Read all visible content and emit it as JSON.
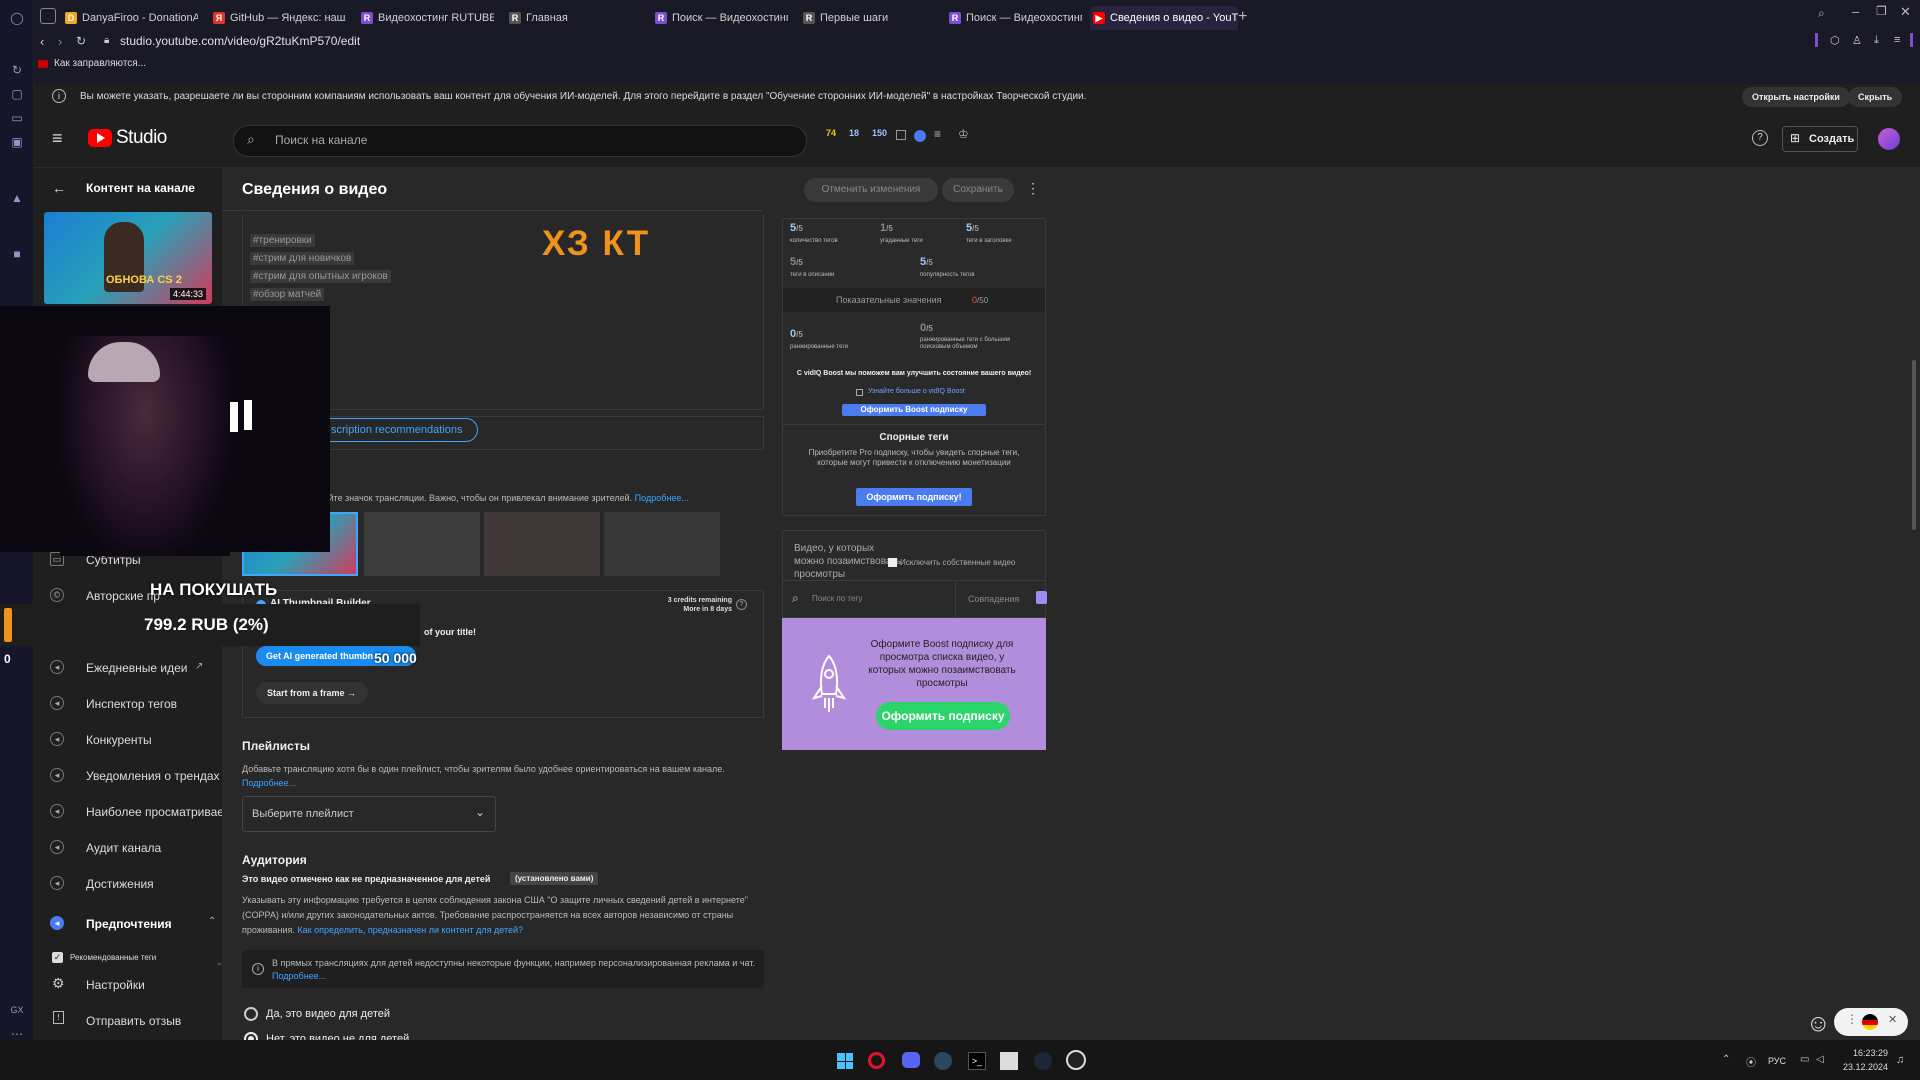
{
  "browser": {
    "tabs": [
      {
        "label": "DanyaFiroo - DonationAle",
        "fav_color": "#f5a623"
      },
      {
        "label": "GitHub — Яндекс: нашло",
        "fav_color": "#e5322d"
      },
      {
        "label": "Видеохостинг RUTUBE. С",
        "fav_color": "#7b4dd8"
      },
      {
        "label": "Главная",
        "fav_color": "#444"
      },
      {
        "label": "Поиск — Видеохостинг R",
        "fav_color": "#7b4dd8"
      },
      {
        "label": "Первые шаги",
        "fav_color": "#444"
      },
      {
        "label": "Поиск — Видеохостинг R",
        "fav_color": "#7b4dd8"
      },
      {
        "label": "Сведения о видео - YouT",
        "fav_color": "#ff0000"
      }
    ],
    "url": "studio.youtube.com/video/gR2tuKmP570/edit",
    "bookmark": "Как заправляются..."
  },
  "banner": {
    "text": "Вы можете указать, разрешаете ли вы сторонним компаниям использовать ваш контент для обучения ИИ-моделей. Для этого перейдите в раздел \"Обучение сторонних ИИ-моделей\" в настройках Творческой студии.",
    "open_settings": "Открыть настройки",
    "hide": "Скрыть"
  },
  "header": {
    "logo_text": "Studio",
    "search_placeholder": "Поиск на канале",
    "stats": {
      "a": "74",
      "b": "18",
      "c": "150"
    },
    "create_label": "Создать"
  },
  "sidebar": {
    "back_label": "Контент на канале",
    "thumb_duration": "4:44:33",
    "thumb_text": "ОБНОВА CS 2",
    "items": [
      {
        "label": "Субтитры",
        "icon": "subtitles-icon"
      },
      {
        "label": "Авторские пр",
        "icon": "copyright-icon"
      },
      {
        "label": "Ежедневные идеи",
        "icon": "vidiq-icon"
      },
      {
        "label": "Инспектор тегов",
        "icon": "vidiq-icon"
      },
      {
        "label": "Конкуренты",
        "icon": "vidiq-icon"
      },
      {
        "label": "Уведомления о трендах",
        "icon": "vidiq-icon"
      },
      {
        "label": "Наиболее просматривае",
        "icon": "vidiq-icon"
      },
      {
        "label": "Аудит канала",
        "icon": "vidiq-icon"
      },
      {
        "label": "Достижения",
        "icon": "vidiq-icon"
      },
      {
        "label": "Предпочтения",
        "icon": "vidiq-icon"
      }
    ],
    "recommended_tags": "Рекомендованные теги",
    "settings": "Настройки",
    "feedback": "Отправить отзыв"
  },
  "main": {
    "title": "Сведения о видео",
    "undo": "Отменить изменения",
    "save": "Сохранить",
    "overlay_text": "ХЗ КТ",
    "tags": [
      "#тренировки",
      "#стрим для новичков",
      "#стрим для опытных игроков",
      "#обзор матчей"
    ],
    "desc_recs": "scription recommendations",
    "thumb_hint": "зуйте значок трансляции. Важно, чтобы он привлекал внимание зрителей.",
    "thumb_hint_more": "Подробнее...",
    "ai_builder": "AI Thumbnail Builder",
    "credits": "3 credits remaining",
    "credits_more": "More in 8 days",
    "of_title": "of your title!",
    "get_ai": "Get AI generated thumbn",
    "start_frame": "Start from a frame →",
    "playlists_title": "Плейлисты",
    "playlists_desc": "Добавьте трансляцию хотя бы в один плейлист, чтобы зрителям было удобнее ориентироваться на вашем канале.",
    "playlists_more": "Подробнее...",
    "playlist_select": "Выберите плейлист",
    "audience_title": "Аудитория",
    "audience_status": "Это видео отмечено как не предназначенное для детей",
    "audience_badge": "(установлено вами)",
    "audience_desc": "Указывать эту информацию требуется в целях соблюдения закона США \"О защите личных сведений детей в интернете\" (COPPA) и/или других законодательных актов. Требование распространяется на всех авторов независимо от страны проживания.",
    "audience_link": "Как определить, предназначен ли контент для детей?",
    "info_note": "В прямых трансляциях для детей недоступны некоторые функции, например персонализированная реклама и чат.",
    "info_more": "Подробнее...",
    "radio_yes": "Да, это видео для детей",
    "radio_no": "Нет, это видео не для детей"
  },
  "right_panel": {
    "metrics": [
      {
        "value": "5",
        "max": "/5",
        "label": "количество тегов"
      },
      {
        "value": "1",
        "max": "/5",
        "label": "угаданные теги"
      },
      {
        "value": "5",
        "max": "/5",
        "label": "теги в заголовке"
      },
      {
        "value": "5",
        "max": "/5",
        "label": "теги в описании"
      },
      {
        "value": "5",
        "max": "/5",
        "label": "популярность тегов"
      }
    ],
    "score_label": "Показательные значения",
    "score_value": "0",
    "score_max": "/50",
    "metrics2": [
      {
        "value": "0",
        "max": "/5",
        "label": "ранжированные теги"
      },
      {
        "value": "0",
        "max": "/5",
        "label": "ранжированные теги с большим поисковым объемом"
      }
    ],
    "boost_note": "С vidIQ Boost мы поможем вам улучшить состояние вашего видео!",
    "boost_learn": "Узнайте больше о vidIQ Boost",
    "boost_btn": "Оформить Boost подписку",
    "disputed_title": "Спорные теги",
    "disputed_desc": "Приобретите Pro подписку, чтобы увидеть спорные теги, которые могут привести к отключению монетизации",
    "subscribe_btn": "Оформить подписку!",
    "borrow_title": "Видео, у которых можно позаимствовать просмотры",
    "exclude_own": "Исключить собственные видео",
    "search_tag": "Поиск по тегу",
    "matches": "Совпадения",
    "promo_text": "Оформите Boost подписку для просмотра списка видео, у которых можно позаимствовать просмотры",
    "promo_btn": "Оформить подписку"
  },
  "overlays": {
    "buy_label": "НА ПОКУШАТЬ",
    "donation_amount": "799.2 RUB (2%)",
    "goal_value": "50 000",
    "counter": "0"
  },
  "taskbar": {
    "lang": "РУС",
    "time": "16:23:29",
    "date": "23.12.2024"
  },
  "colors": {
    "accent": "#3ea6ff",
    "brand_red": "#ff0000",
    "vidiq_blue": "#4a7cf0",
    "promo_purple": "#b28ddb",
    "promo_green": "#2bd56b",
    "overlay_orange": "#f0921e"
  }
}
